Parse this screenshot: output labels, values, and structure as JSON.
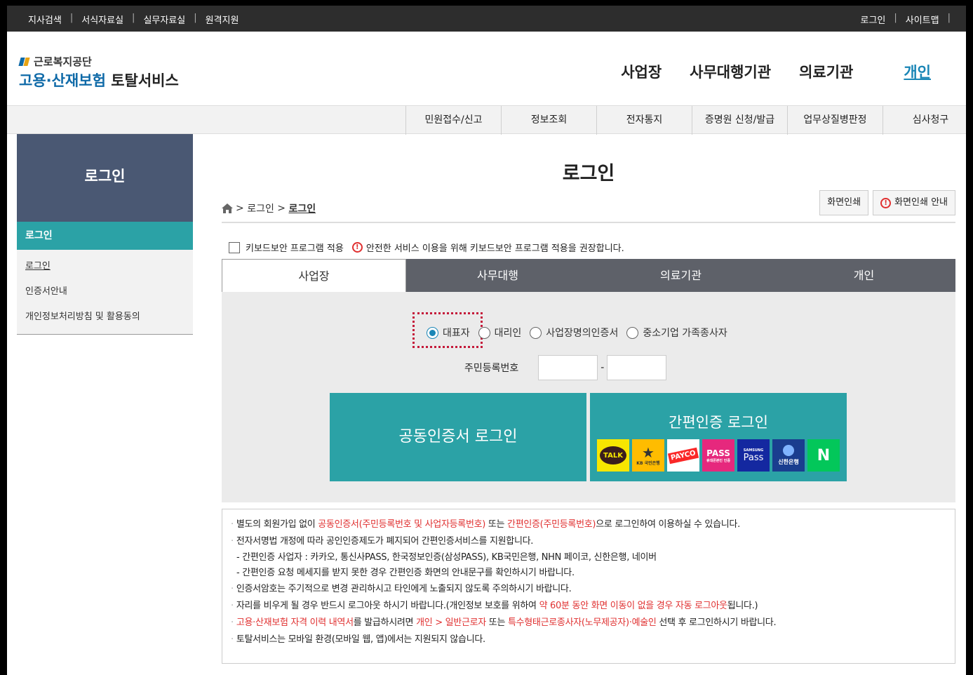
{
  "topbar": {
    "left_links": [
      "지사검색",
      "서식자료실",
      "실무자료실",
      "원격지원"
    ],
    "right_links": [
      "로그인",
      "사이트맵"
    ],
    "separator": "|"
  },
  "header": {
    "logo_small": "근로복지공단",
    "logo_big_part1": "고용·산재보험",
    "logo_big_part2": " 토탈서비스",
    "nav": [
      "사업장",
      "사무대행기관",
      "의료기관"
    ],
    "nav_active": "개인",
    "accent_color": "#1a86b6"
  },
  "subnav": [
    "민원접수/신고",
    "정보조회",
    "전자통지",
    "증명원 신청/발급",
    "업무상질병판정",
    "심사청구"
  ],
  "sidebar": {
    "title": "로그인",
    "active": "로그인",
    "items": [
      "로그인",
      "인증서안내",
      "개인정보처리방침 및 활용동의"
    ]
  },
  "main": {
    "title": "로그인",
    "breadcrumb": {
      "sep1": ">",
      "item1": "로그인",
      "sep2": ">",
      "current": "로그인"
    },
    "print_btn": "화면인쇄",
    "print_guide_btn": "화면인쇄 안내",
    "warn_mark": "!",
    "keyboard_check_label": "키보드보안 프로그램 적용",
    "keyboard_notice": "안전한 서비스 이용을 위해 키보드보안 프로그램 적용을 권장합니다.",
    "tabs": [
      "사업장",
      "사무대행",
      "의료기관",
      "개인"
    ],
    "active_tab": "사업장",
    "radios": [
      "대표자",
      "대리인",
      "사업장명의인증서",
      "중소기업 가족종사자"
    ],
    "selected_radio": "대표자",
    "rrn_label": "주민등록번호",
    "rrn_dash": "-",
    "cert_login": "공동인증서 로그인",
    "easy_login": "간편인증 로그인",
    "easy_icons": [
      "kakao-talk-icon",
      "kb-bank-icon",
      "payco-icon",
      "pass-icon",
      "samsung-pass-icon",
      "shinhan-bank-icon",
      "naver-icon"
    ],
    "easy_icon_labels": {
      "talk": "TALK",
      "kb": "KB 국민은행",
      "payco": "PAYCO",
      "pass": "PASS",
      "pass_sub": "휴대폰본인 인증",
      "samsung_top": "SAMSUNG",
      "samsung": "Pass",
      "shinhan": "신한은행",
      "naver": "N"
    }
  },
  "info": {
    "bullet": "·",
    "l1a": "별도의 회원가입 없이 ",
    "l1b": "공동인증서(주민등록번호 및 사업자등록번호)",
    "l1c": " 또는 ",
    "l1d": "간편인증(주민등록번호)",
    "l1e": "으로 로그인하여 이용하실 수 있습니다.",
    "l2": "전자서명법 개정에 따라 공인인증제도가 폐지되어 간편인증서비스를 지원합니다.",
    "l3": "- 간편인증 사업자 : 카카오, 통신사PASS, 한국정보인증(삼성PASS), KB국민은행, NHN 페이코, 신한은행, 네이버",
    "l4": "- 간편인증 요청 메세지를 받지 못한 경우 간편인증 화면의 안내문구를 확인하시기 바랍니다.",
    "l5": "인증서암호는 주기적으로 변경 관리하시고 타인에게 노출되지 않도록 주의하시기 바랍니다.",
    "l6a": "자리를 비우게 될 경우 반드시 로그아웃 하시기 바랍니다.(개인정보 보호를 위하여 ",
    "l6b": "약 60분 동안 화면 이동이 없을 경우 자동 로그아웃",
    "l6c": "됩니다.)",
    "l7a": "고용·산재보험 자격 이력 내역서",
    "l7b": "를 발급하시려면 ",
    "l7c": "개인 > 일반근로자",
    "l7d": " 또는 ",
    "l7e": "특수형태근로종사자(노무제공자)·예술인",
    "l7f": " 선택 후 로그인하시기 바랍니다.",
    "l8": "토탈서비스는 모바일 환경(모바일 웹, 앱)에서는 지원되지 않습니다."
  }
}
